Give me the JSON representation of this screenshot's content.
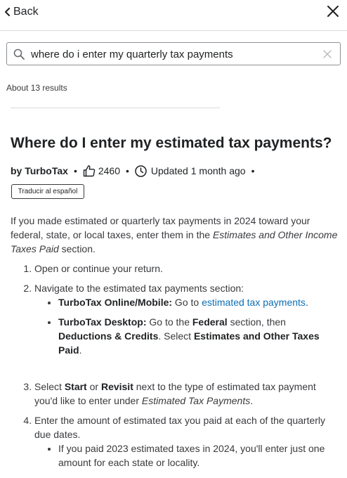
{
  "header": {
    "back_label": "Back"
  },
  "search": {
    "query": "where do i enter my quarterly tax payments"
  },
  "results": {
    "count_text": "About 13 results"
  },
  "article": {
    "title": "Where do I enter my estimated tax payments?",
    "author": "by TurboTax",
    "likes": "2460",
    "updated": "Updated 1 month ago",
    "translate_label": "Traducir al español",
    "intro": {
      "part1": "If you made estimated or quarterly tax payments in 2024 toward your federal, state, or local taxes, enter them in the ",
      "emph": "Estimates and Other Income Taxes Paid",
      "part2": " section."
    },
    "steps": [
      {
        "text": "Open or continue your return."
      },
      {
        "text": "Navigate to the estimated tax payments section:",
        "sub": [
          {
            "label": "TurboTax Online/Mobile:",
            "pre": " Go to ",
            "link": "estimated tax payments",
            "post": "."
          },
          {
            "label": "TurboTax Desktop:",
            "pre": " Go to the ",
            "b1": "Federal",
            "mid": " section, then ",
            "b2": "Deductions & Credits",
            "mid2": ". Select ",
            "b3": "Estimates and Other Taxes Paid",
            "post": "."
          }
        ]
      },
      {
        "pre": "Select ",
        "b1": "Start",
        "mid": " or ",
        "b2": "Revisit",
        "mid2": " next to the type of estimated tax payment you'd like to enter under ",
        "em": "Estimated Tax Payments",
        "post": "."
      },
      {
        "text": "Enter the amount of estimated tax you paid at each of the quarterly due dates.",
        "sub": [
          {
            "text": "If you paid 2023 estimated taxes in 2024, you'll enter just one amount for each state or locality."
          }
        ]
      }
    ]
  },
  "icons": {
    "back": "chevron-left-icon",
    "close": "close-icon",
    "search": "search-icon",
    "clear": "clear-icon",
    "like": "thumbs-up-icon",
    "updated": "clock-icon"
  },
  "colors": {
    "link": "#0d6fb5",
    "text": "#1f2123",
    "muted": "#393a3d",
    "border": "#8d9196"
  }
}
